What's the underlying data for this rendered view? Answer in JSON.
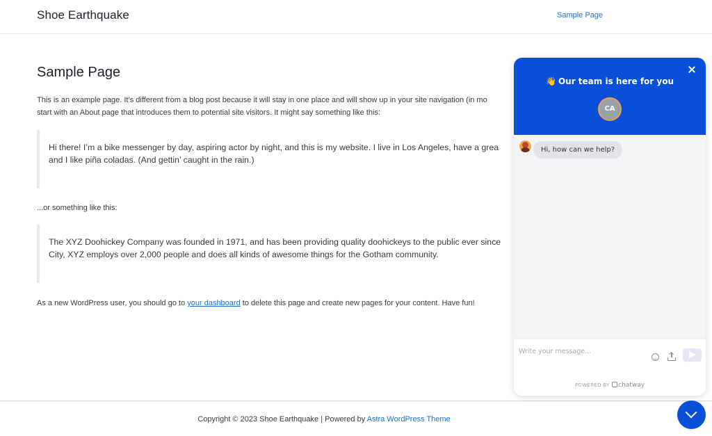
{
  "header": {
    "site_title": "Shoe Earthquake",
    "nav_item": "Sample Page"
  },
  "main": {
    "title": "Sample Page",
    "intro_line1": "This is an example page. It’s different from a blog post because it will stay in one place and will show up in your site navigation (in mo",
    "intro_line2": "start with an About page that introduces them to potential site visitors. It might say something like this:",
    "quote1_line1": "Hi there! I’m a bike messenger by day, aspiring actor by night, and this is my website. I live in Los Angeles, have a grea",
    "quote1_line2": "and I like piña coladas. (And gettin’ caught in the rain.)",
    "or_text": "...or something like this:",
    "quote2_line1": "The XYZ Doohickey Company was founded in 1971, and has been providing quality doohickeys to the public ever since",
    "quote2_line2": "City, XYZ employs over 2,000 people and does all kinds of awesome things for the Gotham community.",
    "outro_before": "As a new WordPress user, you should go to ",
    "outro_link": "your dashboard",
    "outro_after": " to delete this page and create new pages for your content. Have fun!"
  },
  "footer": {
    "copyright": "Copyright © 2023 Shoe Earthquake | Powered by ",
    "theme_link": "Astra WordPress Theme"
  },
  "chat": {
    "wave_emoji": "👋",
    "header_title": "Our team is here for you",
    "agent_initials": "CA",
    "greeting": "Hi, how can we help?",
    "input_placeholder": "Write your message...",
    "powered_by": "POWERED BY",
    "brand_name": "chatway",
    "accent_color": "#0a4fd9"
  }
}
